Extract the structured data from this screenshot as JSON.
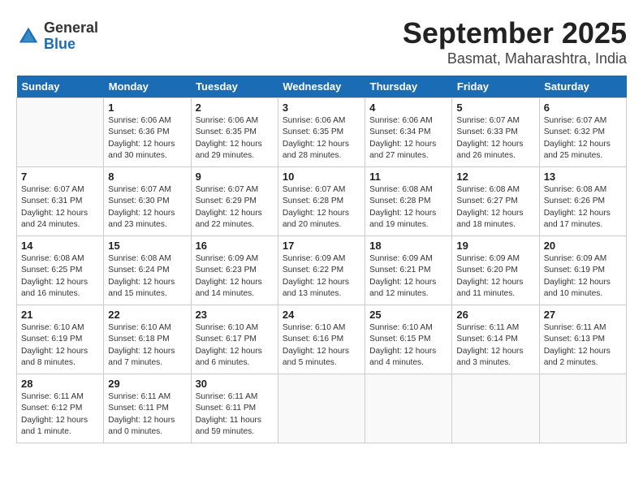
{
  "logo": {
    "general": "General",
    "blue": "Blue"
  },
  "header": {
    "month": "September 2025",
    "location": "Basmat, Maharashtra, India"
  },
  "weekdays": [
    "Sunday",
    "Monday",
    "Tuesday",
    "Wednesday",
    "Thursday",
    "Friday",
    "Saturday"
  ],
  "weeks": [
    [
      {
        "day": "",
        "sunrise": "",
        "sunset": "",
        "daylight": ""
      },
      {
        "day": "1",
        "sunrise": "Sunrise: 6:06 AM",
        "sunset": "Sunset: 6:36 PM",
        "daylight": "Daylight: 12 hours and 30 minutes."
      },
      {
        "day": "2",
        "sunrise": "Sunrise: 6:06 AM",
        "sunset": "Sunset: 6:35 PM",
        "daylight": "Daylight: 12 hours and 29 minutes."
      },
      {
        "day": "3",
        "sunrise": "Sunrise: 6:06 AM",
        "sunset": "Sunset: 6:35 PM",
        "daylight": "Daylight: 12 hours and 28 minutes."
      },
      {
        "day": "4",
        "sunrise": "Sunrise: 6:06 AM",
        "sunset": "Sunset: 6:34 PM",
        "daylight": "Daylight: 12 hours and 27 minutes."
      },
      {
        "day": "5",
        "sunrise": "Sunrise: 6:07 AM",
        "sunset": "Sunset: 6:33 PM",
        "daylight": "Daylight: 12 hours and 26 minutes."
      },
      {
        "day": "6",
        "sunrise": "Sunrise: 6:07 AM",
        "sunset": "Sunset: 6:32 PM",
        "daylight": "Daylight: 12 hours and 25 minutes."
      }
    ],
    [
      {
        "day": "7",
        "sunrise": "Sunrise: 6:07 AM",
        "sunset": "Sunset: 6:31 PM",
        "daylight": "Daylight: 12 hours and 24 minutes."
      },
      {
        "day": "8",
        "sunrise": "Sunrise: 6:07 AM",
        "sunset": "Sunset: 6:30 PM",
        "daylight": "Daylight: 12 hours and 23 minutes."
      },
      {
        "day": "9",
        "sunrise": "Sunrise: 6:07 AM",
        "sunset": "Sunset: 6:29 PM",
        "daylight": "Daylight: 12 hours and 22 minutes."
      },
      {
        "day": "10",
        "sunrise": "Sunrise: 6:07 AM",
        "sunset": "Sunset: 6:28 PM",
        "daylight": "Daylight: 12 hours and 20 minutes."
      },
      {
        "day": "11",
        "sunrise": "Sunrise: 6:08 AM",
        "sunset": "Sunset: 6:28 PM",
        "daylight": "Daylight: 12 hours and 19 minutes."
      },
      {
        "day": "12",
        "sunrise": "Sunrise: 6:08 AM",
        "sunset": "Sunset: 6:27 PM",
        "daylight": "Daylight: 12 hours and 18 minutes."
      },
      {
        "day": "13",
        "sunrise": "Sunrise: 6:08 AM",
        "sunset": "Sunset: 6:26 PM",
        "daylight": "Daylight: 12 hours and 17 minutes."
      }
    ],
    [
      {
        "day": "14",
        "sunrise": "Sunrise: 6:08 AM",
        "sunset": "Sunset: 6:25 PM",
        "daylight": "Daylight: 12 hours and 16 minutes."
      },
      {
        "day": "15",
        "sunrise": "Sunrise: 6:08 AM",
        "sunset": "Sunset: 6:24 PM",
        "daylight": "Daylight: 12 hours and 15 minutes."
      },
      {
        "day": "16",
        "sunrise": "Sunrise: 6:09 AM",
        "sunset": "Sunset: 6:23 PM",
        "daylight": "Daylight: 12 hours and 14 minutes."
      },
      {
        "day": "17",
        "sunrise": "Sunrise: 6:09 AM",
        "sunset": "Sunset: 6:22 PM",
        "daylight": "Daylight: 12 hours and 13 minutes."
      },
      {
        "day": "18",
        "sunrise": "Sunrise: 6:09 AM",
        "sunset": "Sunset: 6:21 PM",
        "daylight": "Daylight: 12 hours and 12 minutes."
      },
      {
        "day": "19",
        "sunrise": "Sunrise: 6:09 AM",
        "sunset": "Sunset: 6:20 PM",
        "daylight": "Daylight: 12 hours and 11 minutes."
      },
      {
        "day": "20",
        "sunrise": "Sunrise: 6:09 AM",
        "sunset": "Sunset: 6:19 PM",
        "daylight": "Daylight: 12 hours and 10 minutes."
      }
    ],
    [
      {
        "day": "21",
        "sunrise": "Sunrise: 6:10 AM",
        "sunset": "Sunset: 6:19 PM",
        "daylight": "Daylight: 12 hours and 8 minutes."
      },
      {
        "day": "22",
        "sunrise": "Sunrise: 6:10 AM",
        "sunset": "Sunset: 6:18 PM",
        "daylight": "Daylight: 12 hours and 7 minutes."
      },
      {
        "day": "23",
        "sunrise": "Sunrise: 6:10 AM",
        "sunset": "Sunset: 6:17 PM",
        "daylight": "Daylight: 12 hours and 6 minutes."
      },
      {
        "day": "24",
        "sunrise": "Sunrise: 6:10 AM",
        "sunset": "Sunset: 6:16 PM",
        "daylight": "Daylight: 12 hours and 5 minutes."
      },
      {
        "day": "25",
        "sunrise": "Sunrise: 6:10 AM",
        "sunset": "Sunset: 6:15 PM",
        "daylight": "Daylight: 12 hours and 4 minutes."
      },
      {
        "day": "26",
        "sunrise": "Sunrise: 6:11 AM",
        "sunset": "Sunset: 6:14 PM",
        "daylight": "Daylight: 12 hours and 3 minutes."
      },
      {
        "day": "27",
        "sunrise": "Sunrise: 6:11 AM",
        "sunset": "Sunset: 6:13 PM",
        "daylight": "Daylight: 12 hours and 2 minutes."
      }
    ],
    [
      {
        "day": "28",
        "sunrise": "Sunrise: 6:11 AM",
        "sunset": "Sunset: 6:12 PM",
        "daylight": "Daylight: 12 hours and 1 minute."
      },
      {
        "day": "29",
        "sunrise": "Sunrise: 6:11 AM",
        "sunset": "Sunset: 6:11 PM",
        "daylight": "Daylight: 12 hours and 0 minutes."
      },
      {
        "day": "30",
        "sunrise": "Sunrise: 6:11 AM",
        "sunset": "Sunset: 6:11 PM",
        "daylight": "Daylight: 11 hours and 59 minutes."
      },
      {
        "day": "",
        "sunrise": "",
        "sunset": "",
        "daylight": ""
      },
      {
        "day": "",
        "sunrise": "",
        "sunset": "",
        "daylight": ""
      },
      {
        "day": "",
        "sunrise": "",
        "sunset": "",
        "daylight": ""
      },
      {
        "day": "",
        "sunrise": "",
        "sunset": "",
        "daylight": ""
      }
    ]
  ]
}
